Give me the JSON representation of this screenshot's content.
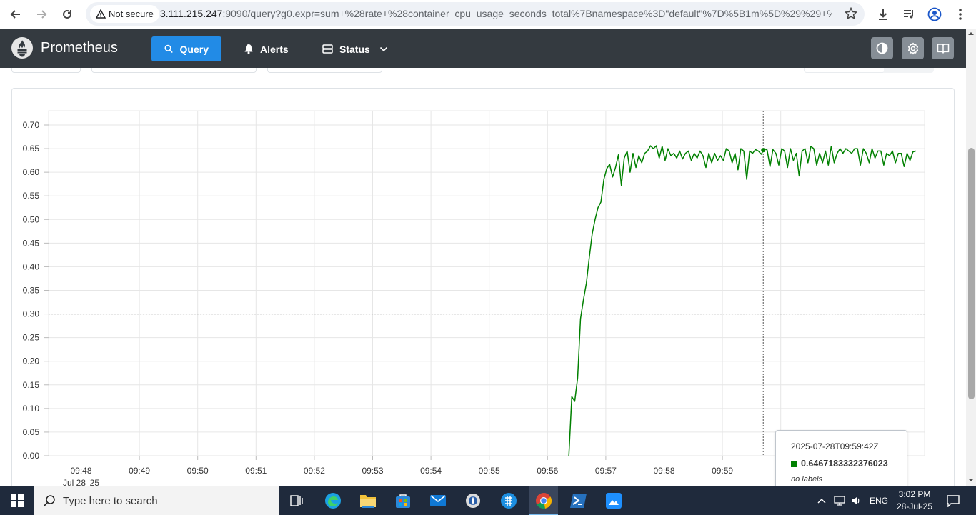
{
  "browser": {
    "not_secure": "Not secure",
    "url_host": "3.111.215.247",
    "url_rest": ":9090/query?g0.expr=sum+%28rate+%28container_cpu_usage_seconds_total%7Bnamespace%3D\"default\"%7D%5B1m%5D%29%29+%2..."
  },
  "navbar": {
    "brand": "Prometheus",
    "query": "Query",
    "alerts": "Alerts",
    "status": "Status"
  },
  "tooltip": {
    "timestamp": "2025-07-28T09:59:42Z",
    "value": "0.6467183332376023",
    "labels": "no labels",
    "color": "#008000"
  },
  "chart_data": {
    "type": "line",
    "x_tick_labels": [
      "09:48",
      "09:49",
      "09:50",
      "09:51",
      "09:52",
      "09:53",
      "09:54",
      "09:55",
      "09:56",
      "09:57",
      "09:58",
      "09:59",
      "1"
    ],
    "x_date_label": "Jul 28 '25",
    "y_tick_labels": [
      "0.00",
      "0.05",
      "0.10",
      "0.15",
      "0.20",
      "0.25",
      "0.30",
      "0.35",
      "0.40",
      "0.45",
      "0.50",
      "0.55",
      "0.60",
      "0.65",
      "0.70"
    ],
    "ylim": [
      0,
      0.7
    ],
    "grid": true,
    "series": [
      {
        "color": "#008000",
        "start": "09:56:22",
        "step_seconds": 3,
        "values": [
          0.0,
          0.125,
          0.115,
          0.165,
          0.29,
          0.33,
          0.365,
          0.42,
          0.47,
          0.5,
          0.525,
          0.537,
          0.585,
          0.608,
          0.617,
          0.59,
          0.61,
          0.637,
          0.572,
          0.63,
          0.645,
          0.6,
          0.64,
          0.61,
          0.635,
          0.62,
          0.64,
          0.645,
          0.656,
          0.65,
          0.656,
          0.63,
          0.655,
          0.625,
          0.65,
          0.635,
          0.64,
          0.63,
          0.645,
          0.628,
          0.64,
          0.645,
          0.625,
          0.64,
          0.63,
          0.645,
          0.635,
          0.61,
          0.64,
          0.62,
          0.64,
          0.625,
          0.635,
          0.625,
          0.65,
          0.645,
          0.62,
          0.64,
          0.605,
          0.65,
          0.645,
          0.585,
          0.645,
          0.64,
          0.648,
          0.645,
          0.638,
          0.65,
          0.647,
          0.612,
          0.648,
          0.64,
          0.615,
          0.65,
          0.645,
          0.61,
          0.65,
          0.625,
          0.64,
          0.592,
          0.645,
          0.65,
          0.62,
          0.655,
          0.65,
          0.615,
          0.64,
          0.62,
          0.645,
          0.615,
          0.655,
          0.62,
          0.64,
          0.65,
          0.64,
          0.65,
          0.645,
          0.64,
          0.65,
          0.65,
          0.615,
          0.65,
          0.64,
          0.62,
          0.65,
          0.63,
          0.645,
          0.645,
          0.615,
          0.64,
          0.635,
          0.645,
          0.62,
          0.64,
          0.64,
          0.612,
          0.64,
          0.625,
          0.643,
          0.645
        ]
      }
    ],
    "hover_x": "09:59:42",
    "hover_value": 0.6467183332376023,
    "hover_y_line": 0.3
  },
  "taskbar": {
    "search_placeholder": "Type here to search",
    "lang": "ENG",
    "time": "3:02 PM",
    "date": "28-Jul-25"
  }
}
